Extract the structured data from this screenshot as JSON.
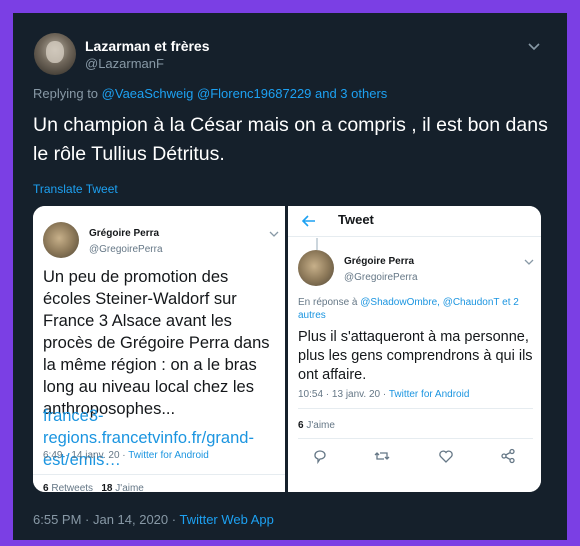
{
  "tweet": {
    "author_name": "Lazarman et frères",
    "author_handle": "@LazarmanF",
    "replying_prefix": "Replying to",
    "reply_mentions": "@VaeaSchweig @Florenc19687229 and 3 others",
    "text": "Un champion à la César mais on a compris , il est bon dans le rôle Tullius Détritus.",
    "translate_label": "Translate Tweet",
    "timestamp": "6:55 PM · Jan 14, 2020 · ",
    "app": "Twitter Web App"
  },
  "left_card": {
    "name": "Grégoire Perra",
    "handle": "@GregoirePerra",
    "text": "Un peu de promotion des écoles Steiner-Waldorf sur France 3 Alsace avant les procès de Grégoire Perra dans la même région : on a le bras long au niveau local chez les anthroposophes...",
    "link": "france3-regions.francetvinfo.fr/grand-est/emis…",
    "time": "6:49 · 14 janv. 20 · ",
    "via": "Twitter for Android",
    "retweets_count": "6",
    "retweets_label": "Retweets",
    "likes_count": "18",
    "likes_label": "J'aime"
  },
  "right_card": {
    "back_icon": "arrow-left-icon",
    "title": "Tweet",
    "name": "Grégoire Perra",
    "handle": "@GregoirePerra",
    "reply_prefix": "En réponse à",
    "reply_mentions": "@ShadowOmbre, @ChaudonT et 2 autres",
    "text": "Plus il s'attaqueront à ma personne, plus les gens comprendrons à qui ils ont affaire.",
    "time": "10:54 · 13 janv. 20 · ",
    "via": "Twitter for Android",
    "likes_count": "6",
    "likes_label": "J'aime"
  },
  "colors": {
    "background": "#7b3fe4",
    "tweet_bg": "#15202b",
    "accent": "#1da1f2",
    "muted": "#8899a6"
  }
}
